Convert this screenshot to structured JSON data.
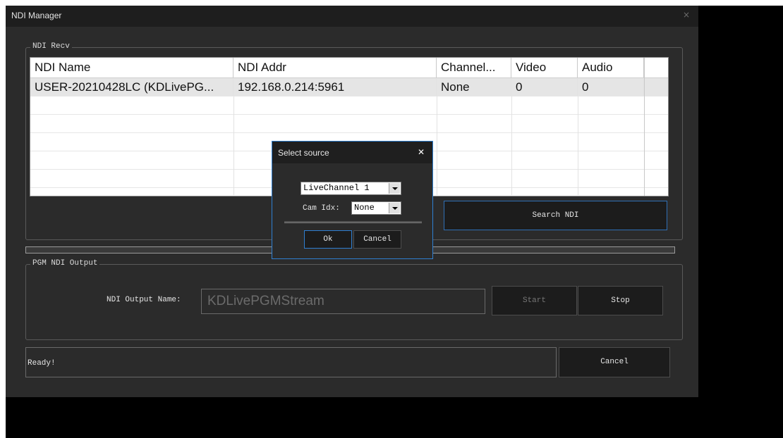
{
  "window": {
    "title": "NDI Manager",
    "close_glyph": "×"
  },
  "recv_group": {
    "label": "NDI Recv",
    "table": {
      "columns": [
        "NDI Name",
        "NDI Addr",
        "Channel...",
        "Video",
        "Audio"
      ],
      "rows": [
        [
          "USER-20210428LC (KDLivePG...",
          "192.168.0.214:5961",
          "None",
          "0",
          "0"
        ]
      ]
    },
    "search_button": "Search NDI"
  },
  "output_group": {
    "label": "PGM NDI Output",
    "name_label": "NDI Output Name:",
    "name_value": "KDLivePGMStream",
    "start_button": "Start",
    "stop_button": "Stop"
  },
  "status": {
    "text": "Ready!",
    "cancel_button": "Cancel"
  },
  "dialog": {
    "title": "Select source",
    "close_glyph": "✕",
    "channel_select": "LiveChannel 1",
    "cam_idx_label": "Cam Idx:",
    "cam_idx_select": "None",
    "ok_button": "Ok",
    "cancel_button": "Cancel"
  },
  "icons": {
    "close": "close-icon",
    "dropdown": "chevron-down-icon"
  },
  "colors": {
    "window_bg": "#2b2b2b",
    "titlebar_bg": "#1e1e1e",
    "focus_border": "#2f7fd1",
    "table_bg": "#ffffff"
  }
}
